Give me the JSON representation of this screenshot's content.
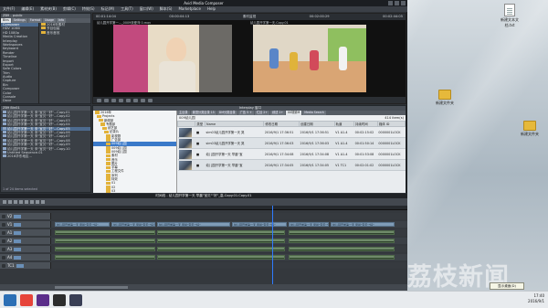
{
  "app": {
    "title": "Avid Media Composer",
    "menu": [
      "文件(F)",
      "编辑(E)",
      "素材夹(B)",
      "剪辑(C)",
      "特效(S)",
      "标记(M)",
      "工具(T)",
      "窗口(W)",
      "脚本(S)",
      "Marketplace",
      "Help"
    ]
  },
  "project": {
    "title": "ZB9 - public",
    "tabs": [
      "Bins",
      "Settings",
      "Format",
      "Usage",
      "Info"
    ],
    "bins": [
      "Composer",
      "HDV 1080i",
      "HD 1080p",
      "Media Creation",
      "Interplay",
      "Workspaces",
      "Keyboard",
      "Render",
      "Timeline",
      "Import",
      "Export",
      "Safe Colors",
      "Trim",
      "Audio",
      "Capture",
      "Bin",
      "Composer",
      "Color",
      "Console",
      "Dave"
    ],
    "folders": [
      "2016年素材",
      "节目包装",
      "音乐音效"
    ]
  },
  "source_monitor": {
    "title": "幼儿园开学第一..._0009张爱萍 0.mov",
    "timecode_in": "00:01:14:04",
    "timecode_out": "00:00:04:13",
    "colors": {
      "left": "#c24a7e",
      "mid": "#e8dcc6",
      "right": "#6c6a66"
    }
  },
  "record_monitor": {
    "title": "幼儿园开学第一天.Copy.01",
    "timecode_in": "00:02:00:29",
    "timecode_out": "00:02:44:05",
    "header_label": "素材监视",
    "colors": {
      "bg": "#8fbf5f",
      "floor": "#d9a574",
      "wall": "#e0d7c6"
    }
  },
  "seq_bin": {
    "title": "ZB9 Bin01",
    "items": [
      "幼儿园开学第一天 采\"宝贝\"\"好\"...Copy.01",
      "幼儿园开学第一天 采\"宝贝\"\"好\"...Copy.02",
      "幼儿园开学第一天 采\"宝贝\"\"好\"...Copy.03",
      "幼儿园开学第一天 采\"宝贝\"\"好\"...Copy.04",
      "幼儿园开学第一天 采\"宝贝\"\"好\"...Copy.05",
      "幼儿园开学第一天 采\"宝贝\"\"好\"...Copy.06",
      "幼儿园开学第一天 采\"宝贝\"\"好\"...Copy.07",
      "幼儿园开学第一天 采\"宝贝\"\"好\"...Copy.08",
      "幼儿园开学第一天 采\"宝贝\"\"好\"...Copy.09",
      "幼儿园开学第一天 采\"宝贝\"\"好\"...Copy.10",
      "Untitled Sequence.01",
      "2016华东地区..."
    ],
    "footer": "1 of 24 items selected"
  },
  "interplay": {
    "title": "Interplay 窗口",
    "tabs": [
      "主目录",
      "置顶分类目录 15",
      "DM分类目录",
      "广告 5 +",
      "栏目 2+",
      "综述 1+",
      "00场景M",
      "Media Search"
    ],
    "path": "009幼儿园",
    "count": "414 item(s)",
    "folders": [
      "2016年",
      "Projects",
      "新闻部",
      "专题部",
      "综艺部",
      "纪录片",
      "影视剧",
      "广告部",
      "009幼儿园",
      "009幼儿园",
      "009幼儿园",
      "素材",
      "音乐",
      "图片",
      "字幕",
      "工程文件",
      "序列",
      "特效",
      "01",
      "02",
      "03",
      "04",
      "05",
      "06",
      "07"
    ],
    "selected_folder_index": 8,
    "columns": [
      "",
      "类型",
      "Name",
      "修改日期",
      "创建日期",
      "轨道",
      "持续时间",
      "媒体 ID"
    ],
    "rows": [
      {
        "type": "■",
        "name": "sim03幼儿园开学第一天 哭",
        "modified": "2016/9/1 17:36:51",
        "created": "2016/9/1 17:36:51",
        "tracks": "V1 A1-4",
        "duration": "00:02:15:02",
        "id": "0000001LOCK"
      },
      {
        "type": "■",
        "name": "sim03幼儿园开学第一天 哭",
        "modified": "2016/9/1 17:36:03",
        "created": "2016/9/1 17:36:03",
        "tracks": "V1 A1-4",
        "duration": "00:01:50:14",
        "id": "0000001LOCK"
      },
      {
        "type": "■",
        "name": "幼儿园开学第一天 早晨\"宝",
        "modified": "2016/9/1 17:34:08",
        "created": "2016/9/1 17:34:08",
        "tracks": "V1 A1-4",
        "duration": "00:01:53:08",
        "id": "0000001LOCK"
      },
      {
        "type": "■",
        "name": "幼儿园开学第一天 早晨\"宝",
        "modified": "2016/9/1 17:34:05",
        "created": "2016/9/1 17:34:05",
        "tracks": "V1 TC1",
        "duration": "00:02:01:02",
        "id": "0000001LOCK"
      }
    ]
  },
  "timeline": {
    "title": "时间线 - 幼儿园开学第一天 早晨\"宝贝\"\"好\"_高.Copy.01.Copy.01",
    "tracks": [
      "V2",
      "V1",
      "A1",
      "A2",
      "A3",
      "A4",
      "TC1"
    ],
    "clip_label": "幼儿园开学第一天 早晨\"宝贝\"\"好\"",
    "playhead_fraction": 0.62
  },
  "desktop": {
    "icons": [
      {
        "label": "新建文本文档.txt",
        "kind": "document"
      },
      {
        "label": "新建文件夹",
        "kind": "folder"
      },
      {
        "label": "新建文件夹",
        "kind": "folder"
      }
    ],
    "watermark_logo": "荔枝",
    "watermark_text": "荔枝新闻"
  },
  "taskbar": {
    "apps": [
      {
        "name": "start",
        "color": "#2c6fb5"
      },
      {
        "name": "chrome",
        "color": "#e6443a"
      },
      {
        "name": "avid",
        "color": "#5b2d8a"
      },
      {
        "name": "media-player",
        "color": "#2d2d2d"
      },
      {
        "name": "interplay",
        "color": "#3a3f55"
      }
    ],
    "time": "17:40",
    "date": "2016/9/1",
    "tooltip": "显示桌面(D)"
  }
}
